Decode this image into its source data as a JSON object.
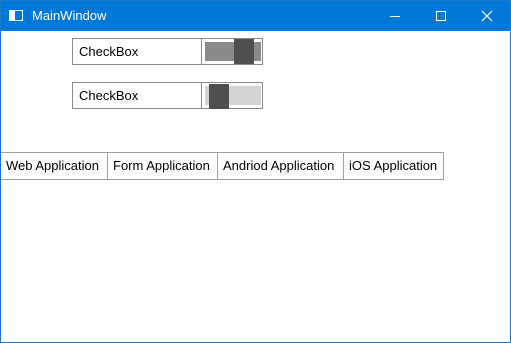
{
  "window": {
    "title": "MainWindow",
    "accent_color": "#0078d7"
  },
  "caption_buttons": {
    "minimize_icon": "minimize-icon",
    "maximize_icon": "maximize-icon",
    "close_icon": "close-icon"
  },
  "toggles": [
    {
      "label": "CheckBox",
      "checked": true
    },
    {
      "label": "CheckBox",
      "checked": false
    }
  ],
  "tabs": [
    {
      "label": "Web Application"
    },
    {
      "label": "Form Application"
    },
    {
      "label": "Andriod Application"
    },
    {
      "label": "iOS Application"
    }
  ]
}
